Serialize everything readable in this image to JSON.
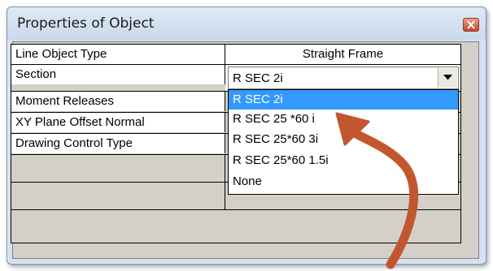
{
  "window": {
    "title": "Properties of Object"
  },
  "properties": {
    "rows": [
      {
        "label": "Line Object Type",
        "value": "Straight Frame"
      },
      {
        "label": "Section",
        "value": "R SEC  2i"
      },
      {
        "label": "Moment Releases",
        "value": ""
      },
      {
        "label": "XY Plane Offset Normal",
        "value": ""
      },
      {
        "label": "Drawing Control Type",
        "value": ""
      },
      {
        "label": "",
        "value": ""
      },
      {
        "label": "",
        "value": ""
      }
    ]
  },
  "section_dropdown": {
    "selected": "R SEC  2i",
    "options": [
      "R SEC  2i",
      "R SEC 25 *60  i",
      "R SEC 25*60  3i",
      "R SEC 25*60 1.5i",
      "None"
    ],
    "highlighted_index": 0
  },
  "annotation": {
    "arrow_color": "#c2572f"
  }
}
